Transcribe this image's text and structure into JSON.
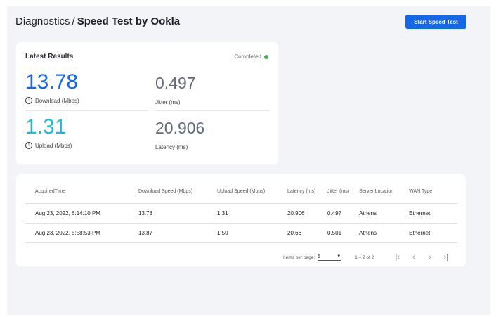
{
  "header": {
    "breadcrumb_root": "Diagnostics",
    "breadcrumb_separator": "/",
    "breadcrumb_current": "Speed Test by Ookla",
    "start_button_label": "Start Speed Test"
  },
  "results": {
    "title": "Latest Results",
    "status": "Completed",
    "status_color": "#3fb35b",
    "download": {
      "value": "13.78",
      "label": "Download (Mbps)",
      "icon": "download-icon",
      "color": "#1467e8"
    },
    "upload": {
      "value": "1.31",
      "label": "Upload (Mbps)",
      "icon": "upload-icon",
      "color": "#25b6de"
    },
    "jitter": {
      "value": "0.497",
      "label": "Jitter (ms)"
    },
    "latency": {
      "value": "20.906",
      "label": "Latency (ms)"
    }
  },
  "table": {
    "columns": [
      "AcquiredTime",
      "Download Speed (Mbps)",
      "Upload Speed (Mbps)",
      "Latency (ms)",
      "Jitter (ms)",
      "Server Location",
      "WAN Type"
    ],
    "rows": [
      [
        "Aug 23, 2022, 6:14:10 PM",
        "13.78",
        "1.31",
        "20.906",
        "0.497",
        "Athens",
        "Ethernet"
      ],
      [
        "Aug 23, 2022, 5:58:53 PM",
        "13.87",
        "1.50",
        "20.66",
        "0.501",
        "Athens",
        "Ethernet"
      ]
    ]
  },
  "paginator": {
    "items_per_page_label": "Items per page:",
    "items_per_page_value": "5",
    "range_label": "1 – 2 of 2"
  },
  "colors": {
    "accent": "#1467e8",
    "background": "#f3f4f7"
  }
}
